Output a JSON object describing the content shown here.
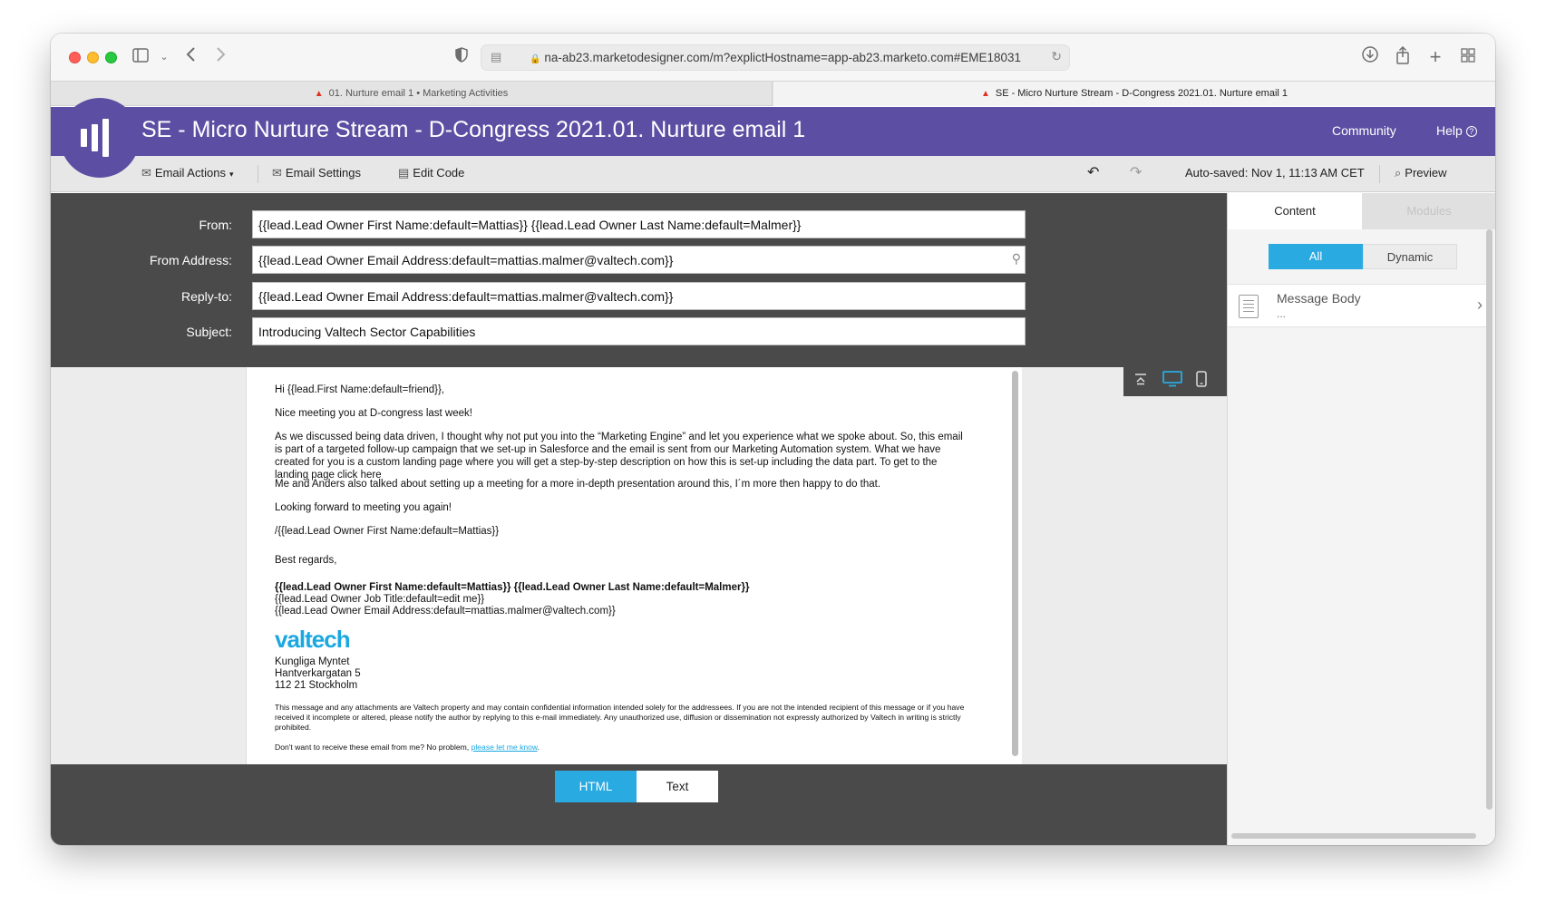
{
  "browser": {
    "url": "na-ab23.marketodesigner.com/m?explictHostname=app-ab23.marketo.com#EME18031",
    "tabs": [
      {
        "label": "01. Nurture email 1 • Marketing Activities"
      },
      {
        "label": "SE - Micro Nurture Stream - D-Congress 2021.01. Nurture email 1"
      }
    ]
  },
  "header": {
    "title": "SE - Micro Nurture Stream - D-Congress 2021.01. Nurture email 1",
    "community": "Community",
    "help": "Help",
    "help_glyph": "?"
  },
  "actions": {
    "email_actions": "Email Actions",
    "email_settings": "Email Settings",
    "edit_code": "Edit Code",
    "autosaved": "Auto-saved: Nov 1, 11:13 AM CET",
    "preview": "Preview"
  },
  "fields": {
    "from_label": "From:",
    "from_value": "{{lead.Lead Owner First Name:default=Mattias}} {{lead.Lead Owner Last Name:default=Malmer}}",
    "from_address_label": "From Address:",
    "from_address_value": "{{lead.Lead Owner Email Address:default=mattias.malmer@valtech.com}}",
    "reply_to_label": "Reply-to:",
    "reply_to_value": "{{lead.Lead Owner Email Address:default=mattias.malmer@valtech.com}}",
    "subject_label": "Subject:",
    "subject_value": "Introducing Valtech Sector Capabilities"
  },
  "email": {
    "greeting": "Hi {{lead.First Name:default=friend}},",
    "line1": "Nice meeting you at D-congress last week!",
    "para1": "As we discussed being data driven, I thought why not put you into the “Marketing Engine” and let you experience what we spoke about. So, this email is part of a targeted follow-up campaign that we set-up in Salesforce and the email is sent from our Marketing Automation system. What we have created for you is a custom landing page where you will get a step-by-step description on how this is set-up including the data part. To get to the landing page click here",
    "para2": "Me and Anders also talked about setting up a meeting for a more in-depth presentation around this, I´m more then happy to do that.",
    "line2": "Looking forward to meeting you again!",
    "sig_short": "/{{lead.Lead Owner First Name:default=Mattias}}",
    "regards": "Best regards,",
    "sig_name": "{{lead.Lead Owner First Name:default=Mattias}} {{lead.Lead Owner Last Name:default=Malmer}}",
    "sig_title": "{{lead.Lead Owner Job Title:default=edit me}}",
    "sig_email": "{{lead.Lead Owner Email Address:default=mattias.malmer@valtech.com}}",
    "logo": "valtech",
    "addr1": "Kungliga Myntet",
    "addr2": "Hantverkargatan 5",
    "addr3": "112 21 Stockholm",
    "disclaimer": "This message and any attachments are Valtech property and may contain confidential information intended solely for the addressees. If you are not the intended recipient of this message or if you have received it incomplete or altered, please notify the author by replying to this e-mail immediately. Any unauthorized use, diffusion or dissemination not expressly authorized by Valtech in writing is strictly prohibited.",
    "unsub_text": "Don't want to receive these email from me? No problem, ",
    "unsub_link": "please let me know",
    "unsub_end": "."
  },
  "bottom": {
    "html": "HTML",
    "text": "Text"
  },
  "panel": {
    "tab_content": "Content",
    "tab_modules": "Modules",
    "filter_all": "All",
    "filter_dynamic": "Dynamic",
    "item_title": "Message Body",
    "item_sub": "..."
  },
  "colors": {
    "brand_purple": "#5c4ea3",
    "accent_blue": "#29aae1",
    "valtech_blue": "#1aa8e0"
  }
}
